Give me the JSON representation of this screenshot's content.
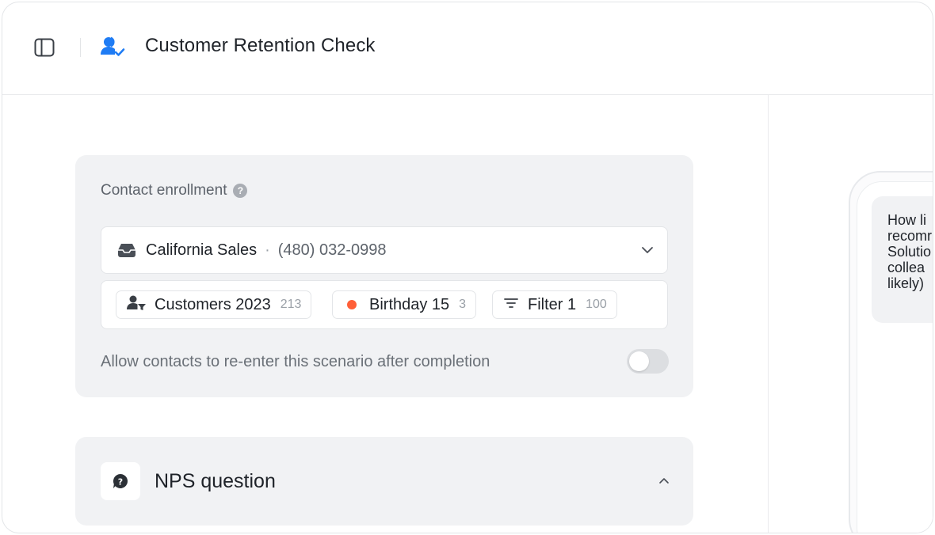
{
  "header": {
    "title": "Customer Retention Check",
    "sidebar_toggle_icon": "sidebar-panel-icon",
    "scenario_icon": "user-check-icon",
    "accent_color": "#1f7cf4"
  },
  "enrollment": {
    "title": "Contact enrollment",
    "help_icon": "question-circle-icon",
    "inbox": {
      "icon": "inbox-icon",
      "name": "California Sales",
      "separator": "·",
      "phone": "(480) 032-0998",
      "dropdown_icon": "chevron-down-icon"
    },
    "segments": [
      {
        "icon": "user-filter-icon",
        "label": "Customers 2023",
        "count": "213"
      },
      {
        "icon": "red-dot-icon",
        "label": "Birthday 15",
        "count": "3",
        "dot_color": "#ff5f38"
      },
      {
        "icon": "filter-lines-icon",
        "label": "Filter 1",
        "count": "100"
      }
    ],
    "reenter_label": "Allow contacts to re-enter this scenario after completion",
    "reenter_enabled": false
  },
  "nps": {
    "title": "NPS question",
    "icon": "chat-question-icon",
    "collapse_icon": "chevron-up-icon"
  },
  "preview": {
    "message_lines": [
      "How li",
      "recomr",
      "Solutio",
      "collea",
      "likely)"
    ]
  }
}
